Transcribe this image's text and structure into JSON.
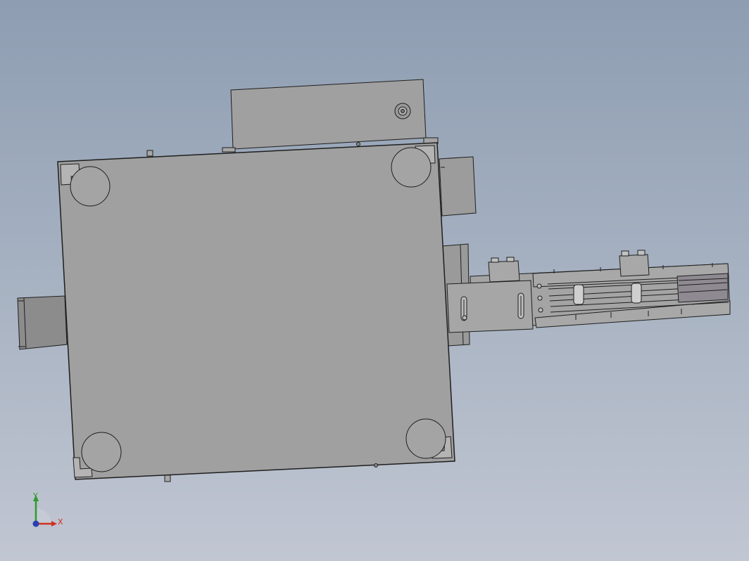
{
  "viewport": {
    "background_top": "#8e9db2",
    "background_bottom": "#c1c6d2",
    "part_fill": "#a0a0a0",
    "part_edge": "#1e1e1e"
  },
  "triad": {
    "x_label": "X",
    "y_label": "Y",
    "x_color": "#d1301f",
    "y_color": "#2e9b2e",
    "z_color": "#2a3fb0"
  }
}
